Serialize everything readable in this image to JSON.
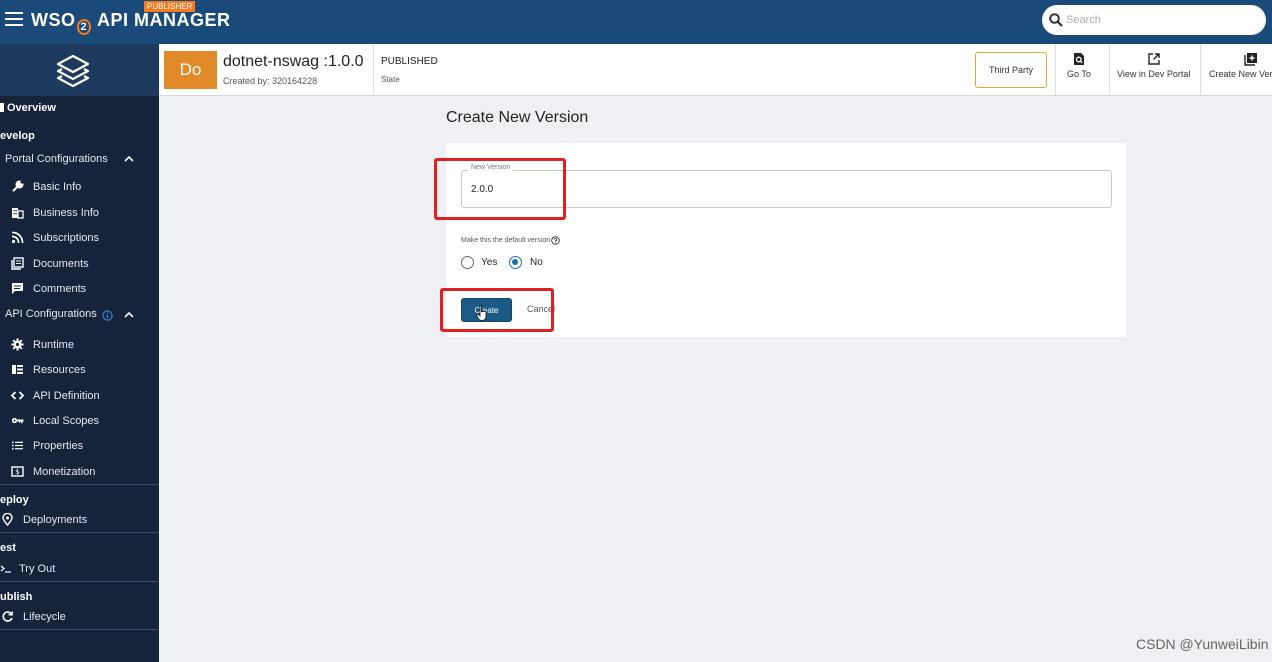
{
  "app": {
    "brand_wso": "WSO",
    "brand_two": "2",
    "brand_name": " API MANAGER",
    "badge": "PUBLISHER"
  },
  "search": {
    "placeholder": "Search"
  },
  "sidebar": {
    "overview": "Overview",
    "develop": "evelop",
    "portal_configurations": "Portal Configurations",
    "portal_items": [
      "Basic Info",
      "Business Info",
      "Subscriptions",
      "Documents",
      "Comments"
    ],
    "api_configurations": "API Configurations",
    "api_items": [
      "Runtime",
      "Resources",
      "API Definition",
      "Local Scopes",
      "Properties",
      "Monetization"
    ],
    "deploy": "eploy",
    "deployments": "Deployments",
    "test": "est",
    "try_out": "Try Out",
    "publish": "ublish",
    "lifecycle": "Lifecycle"
  },
  "api": {
    "avatar": "Do",
    "title": "dotnet-nswag :1.0.0",
    "created_by": "Created by: 320164228",
    "status": "PUBLISHED",
    "state_label": "State",
    "third_party": "Third Party",
    "actions": [
      "Go To",
      "View in Dev Portal",
      "Create New Ver"
    ]
  },
  "form": {
    "page_title": "Create New Version",
    "new_version_label": "New Version",
    "new_version_value": "2.0.0",
    "default_version_label": "Make this the default version",
    "yes_label": "Yes",
    "no_label": "No",
    "selected": "No",
    "create_label": "Create",
    "cancel_label": "Cancel"
  },
  "colors": {
    "topbar": "#1a4a7a",
    "sidebar": "#16233a",
    "accent_orange": "#f47b20",
    "primary_button": "#1b5a84",
    "highlight": "#e02020"
  },
  "watermark": "CSDN @YunweiLibin"
}
